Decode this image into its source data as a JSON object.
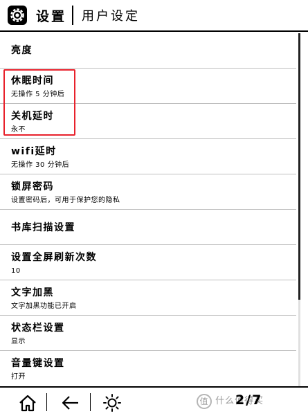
{
  "header": {
    "title": "设置",
    "subtitle": "用户设定"
  },
  "settings": [
    {
      "title": "亮度",
      "subtitle": ""
    },
    {
      "title": "休眠时间",
      "subtitle": "无操作 5 分钟后"
    },
    {
      "title": "关机延时",
      "subtitle": "永不"
    },
    {
      "title": "wifi延时",
      "subtitle": "无操作 30 分钟后"
    },
    {
      "title": "锁屏密码",
      "subtitle": "设置密码后，可用于保护您的隐私"
    },
    {
      "title": "书库扫描设置",
      "subtitle": ""
    },
    {
      "title": "设置全屏刷新次数",
      "subtitle": "10"
    },
    {
      "title": "文字加黑",
      "subtitle": "文字加黑功能已开启"
    },
    {
      "title": "状态栏设置",
      "subtitle": "显示"
    },
    {
      "title": "音量键设置",
      "subtitle": "打开"
    }
  ],
  "highlight_color": "#e8212b",
  "bottom_bar": {
    "page_indicator": "2/7",
    "icons": [
      "home-icon",
      "back-icon",
      "brightness-icon"
    ]
  },
  "watermark": {
    "mark": "值",
    "text": "什么值得买"
  }
}
